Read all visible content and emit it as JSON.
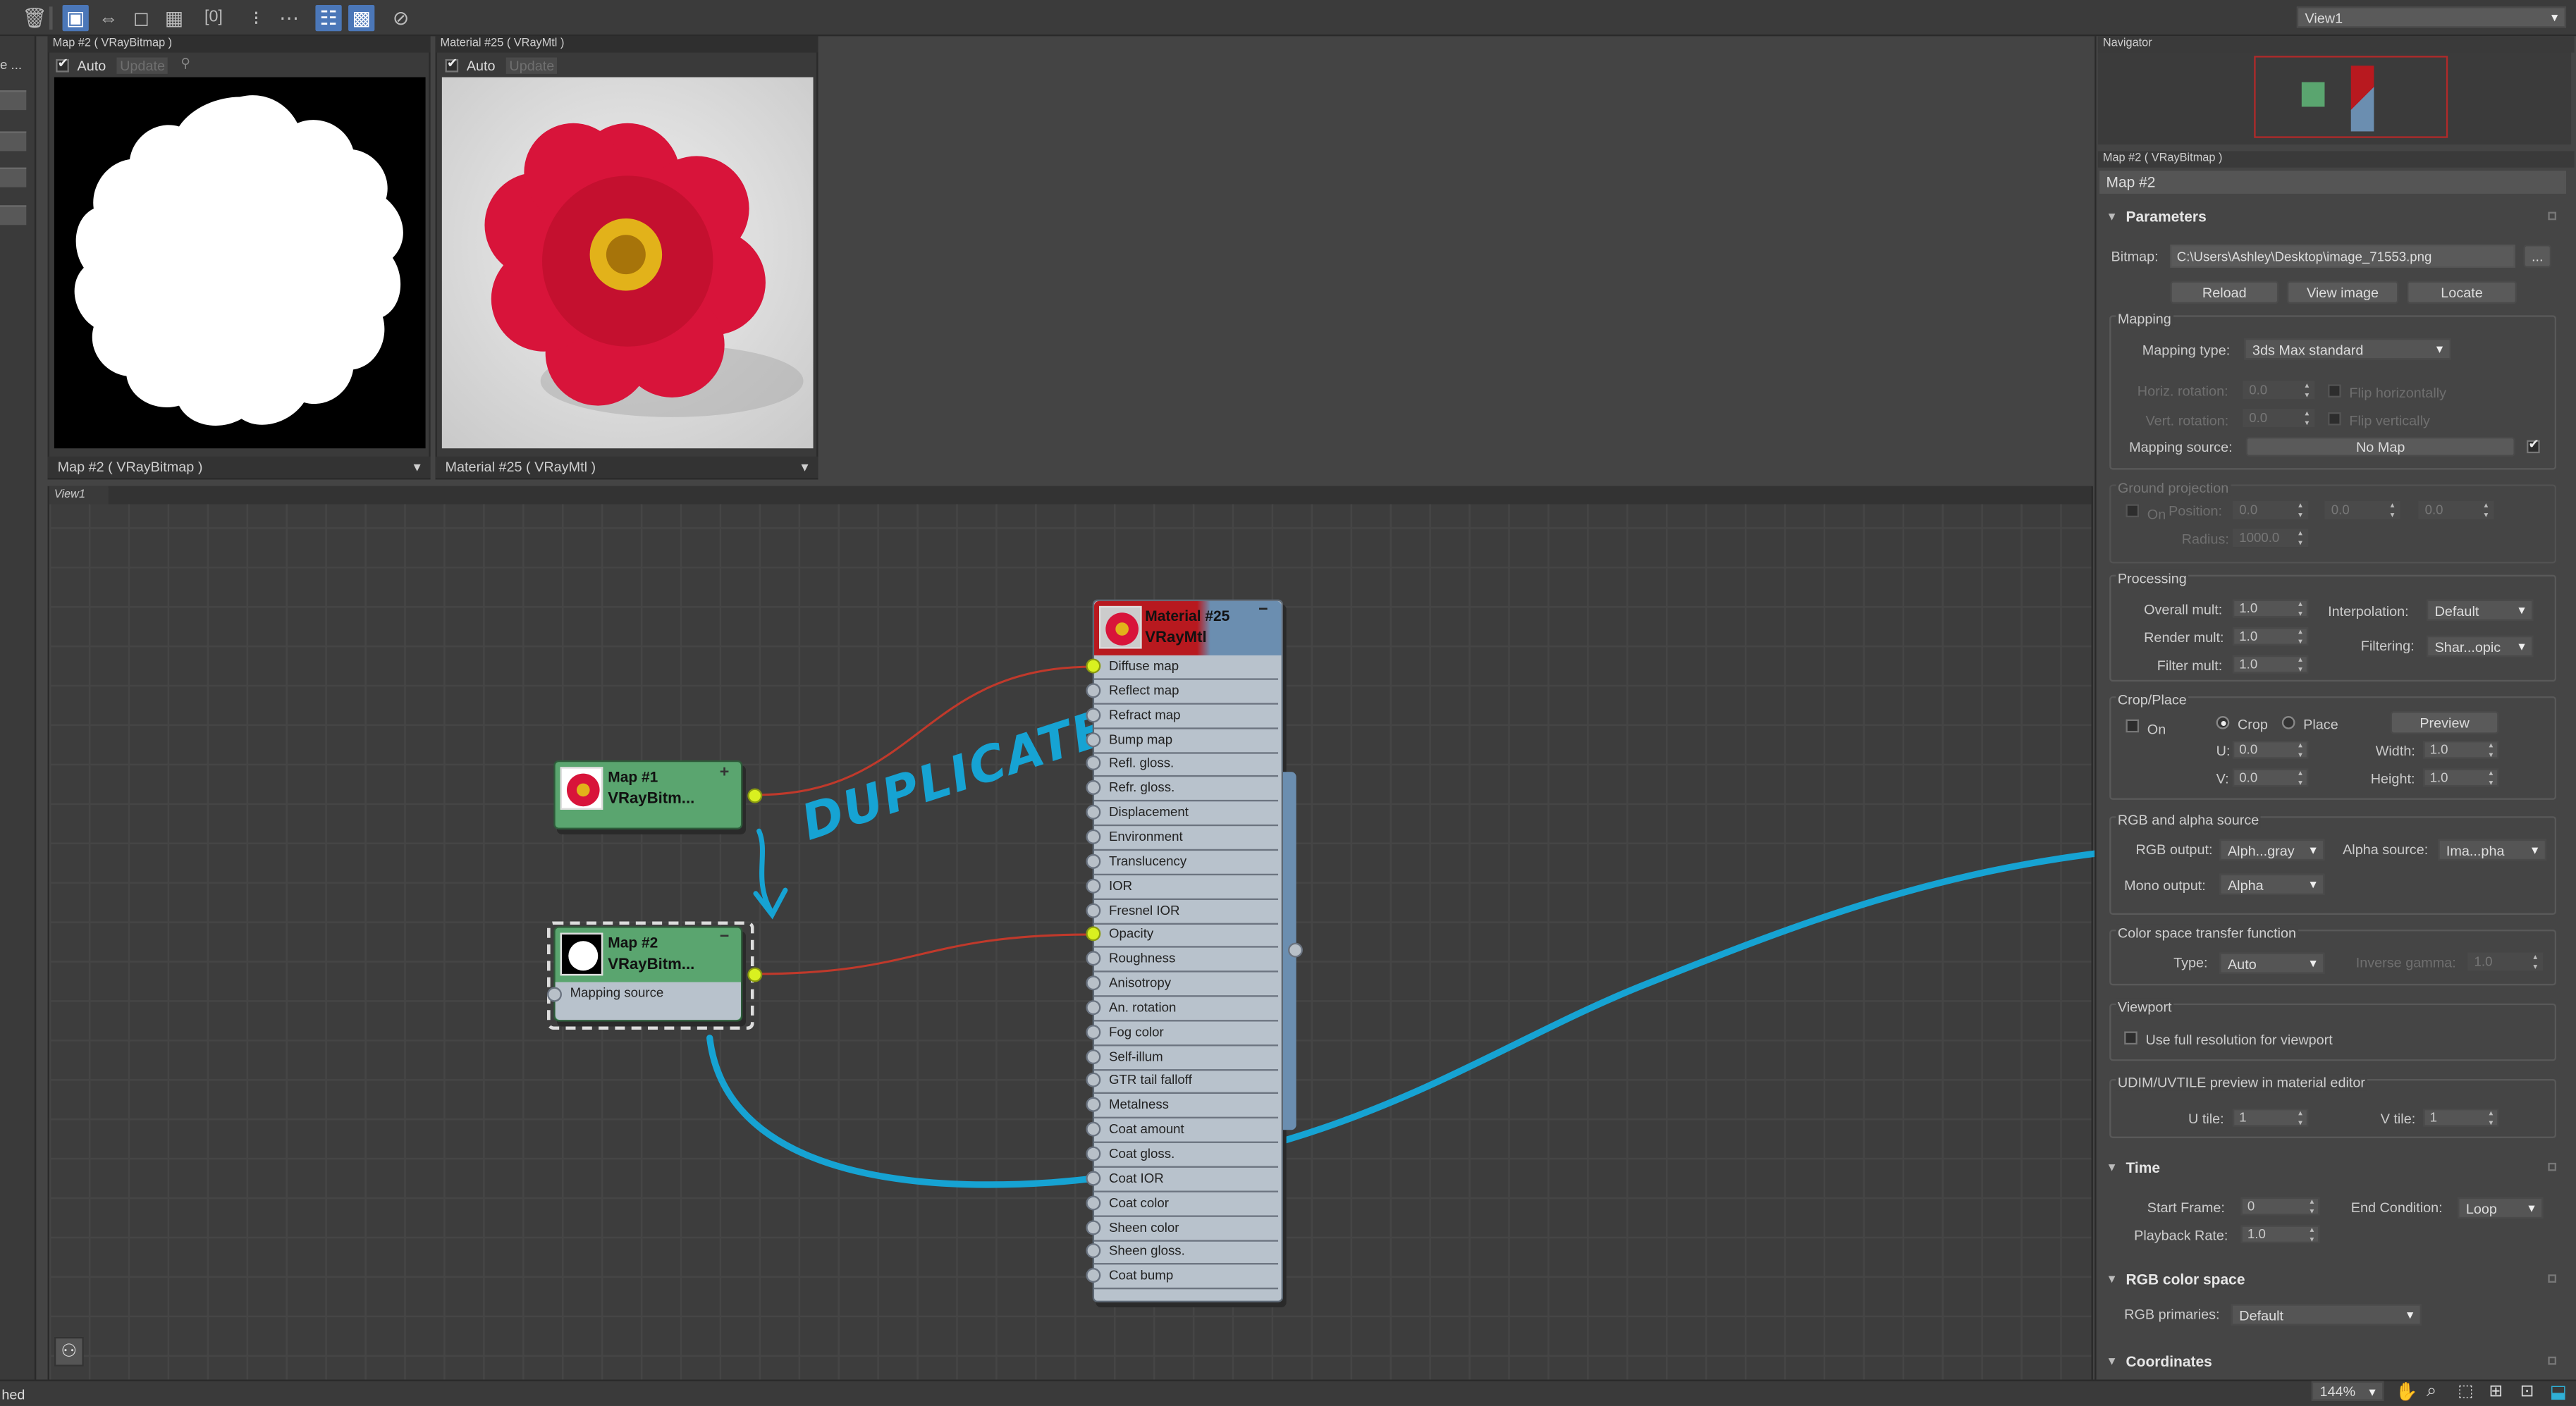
{
  "toolbar": {
    "view_selector": "View1"
  },
  "preview_left": {
    "title": "Map #2  ( VRayBitmap )",
    "auto_label": "Auto",
    "update_label": "Update",
    "footer": "Map #2  ( VRayBitmap )"
  },
  "preview_right": {
    "title": "Material #25  ( VRayMtl )",
    "auto_label": "Auto",
    "update_label": "Update",
    "footer": "Material #25  ( VRayMtl )"
  },
  "left_edge_text": "e ...",
  "view_tab": "View1",
  "nodes": {
    "map1": {
      "name": "Map #1",
      "type": "VRayBitm..."
    },
    "map2": {
      "name": "Map #2",
      "type": "VRayBitm...",
      "slot": "Mapping source"
    },
    "material": {
      "name": "Material #25",
      "type": "VRayMtl",
      "slots": [
        "Diffuse map",
        "Reflect map",
        "Refract map",
        "Bump map",
        "Refl. gloss.",
        "Refr. gloss.",
        "Displacement",
        "Environment",
        "Translucency",
        "IOR",
        "Fresnel IOR",
        "Opacity",
        "Roughness",
        "Anisotropy",
        "An. rotation",
        "Fog color",
        "Self-illum",
        "GTR tail falloff",
        "Metalness",
        "Coat amount",
        "Coat gloss.",
        "Coat IOR",
        "Coat color",
        "Sheen color",
        "Sheen gloss.",
        "Coat bump"
      ]
    }
  },
  "annotation": {
    "text": "DUPLICATE",
    "color": "#16a3d3"
  },
  "navigator": {
    "title": "Navigator"
  },
  "params": {
    "header": "Map #2  ( VRayBitmap )",
    "name_field": "Map #2",
    "rollout_parameters": "Parameters",
    "bitmap_label": "Bitmap:",
    "bitmap_path": "C:\\Users\\Ashley\\Desktop\\image_71553.png",
    "browse_btn": "...",
    "reload_btn": "Reload",
    "view_image_btn": "View image",
    "locate_btn": "Locate",
    "mapping": {
      "group": "Mapping",
      "type_label": "Mapping type:",
      "type_value": "3ds Max standard",
      "horiz_label": "Horiz. rotation:",
      "horiz_value": "0.0",
      "flip_h": "Flip horizontally",
      "vert_label": "Vert. rotation:",
      "vert_value": "0.0",
      "flip_v": "Flip vertically",
      "source_label": "Mapping source:",
      "source_value": "No Map"
    },
    "ground": {
      "group": "Ground projection",
      "on": "On",
      "position_label": "Position:",
      "pos_x": "0.0",
      "pos_y": "0.0",
      "pos_z": "0.0",
      "radius_label": "Radius:",
      "radius_value": "1000.0"
    },
    "processing": {
      "group": "Processing",
      "overall_label": "Overall mult:",
      "overall_value": "1.0",
      "interp_label": "Interpolation:",
      "interp_value": "Default",
      "render_label": "Render mult:",
      "render_value": "1.0",
      "filtering_label": "Filtering:",
      "filtering_value": "Shar...opic",
      "filter_label": "Filter mult:",
      "filter_value": "1.0"
    },
    "crop": {
      "group": "Crop/Place",
      "on": "On",
      "crop": "Crop",
      "place": "Place",
      "preview_btn": "Preview",
      "u_label": "U:",
      "u_value": "0.0",
      "v_label": "V:",
      "v_value": "0.0",
      "width_label": "Width:",
      "width_value": "1.0",
      "height_label": "Height:",
      "height_value": "1.0"
    },
    "rgb_alpha": {
      "group": "RGB and alpha source",
      "rgb_label": "RGB output:",
      "rgb_value": "Alph...gray",
      "alpha_label": "Alpha source:",
      "alpha_value": "Ima...pha",
      "mono_label": "Mono output:",
      "mono_value": "Alpha"
    },
    "colorspace": {
      "group": "Color space transfer function",
      "type_label": "Type:",
      "type_value": "Auto",
      "gamma_label": "Inverse gamma:",
      "gamma_value": "1.0"
    },
    "viewport": {
      "group": "Viewport",
      "full_res": "Use full resolution for viewport"
    },
    "udim": {
      "group": "UDIM/UVTILE preview in material editor",
      "u_label": "U tile:",
      "u_value": "1",
      "v_label": "V tile:",
      "v_value": "1"
    },
    "rollout_time": "Time",
    "time": {
      "start_label": "Start Frame:",
      "start_value": "0",
      "end_label": "End Condition:",
      "end_value": "Loop",
      "rate_label": "Playback Rate:",
      "rate_value": "1.0"
    },
    "rollout_rgb_space": "RGB color space",
    "rgb_space": {
      "primaries_label": "RGB primaries:",
      "primaries_value": "Default"
    },
    "rollout_coordinates": "Coordinates"
  },
  "status": {
    "left": "hed",
    "zoom": "144%"
  }
}
